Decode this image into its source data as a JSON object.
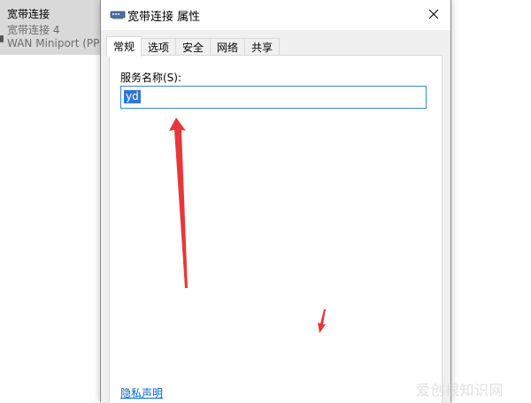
{
  "background": {
    "connection_name": "宽带连接",
    "connection_subtitle": "宽带连接 4",
    "connection_device": "WAN Miniport (PPP"
  },
  "dialog": {
    "title": "宽带连接 属性",
    "tabs": [
      {
        "label": "常规",
        "active": true
      },
      {
        "label": "选项",
        "active": false
      },
      {
        "label": "安全",
        "active": false
      },
      {
        "label": "网络",
        "active": false
      },
      {
        "label": "共享",
        "active": false
      }
    ],
    "service_name_label": "服务名称(S):",
    "service_name_value": "yd",
    "privacy_link": "隐私声明"
  },
  "watermark": "爱创根知识网",
  "colors": {
    "selection": "#2a78d4",
    "focus_border": "#3b87d8",
    "link": "#0066cc",
    "annotation_arrow": "#e8373a"
  }
}
